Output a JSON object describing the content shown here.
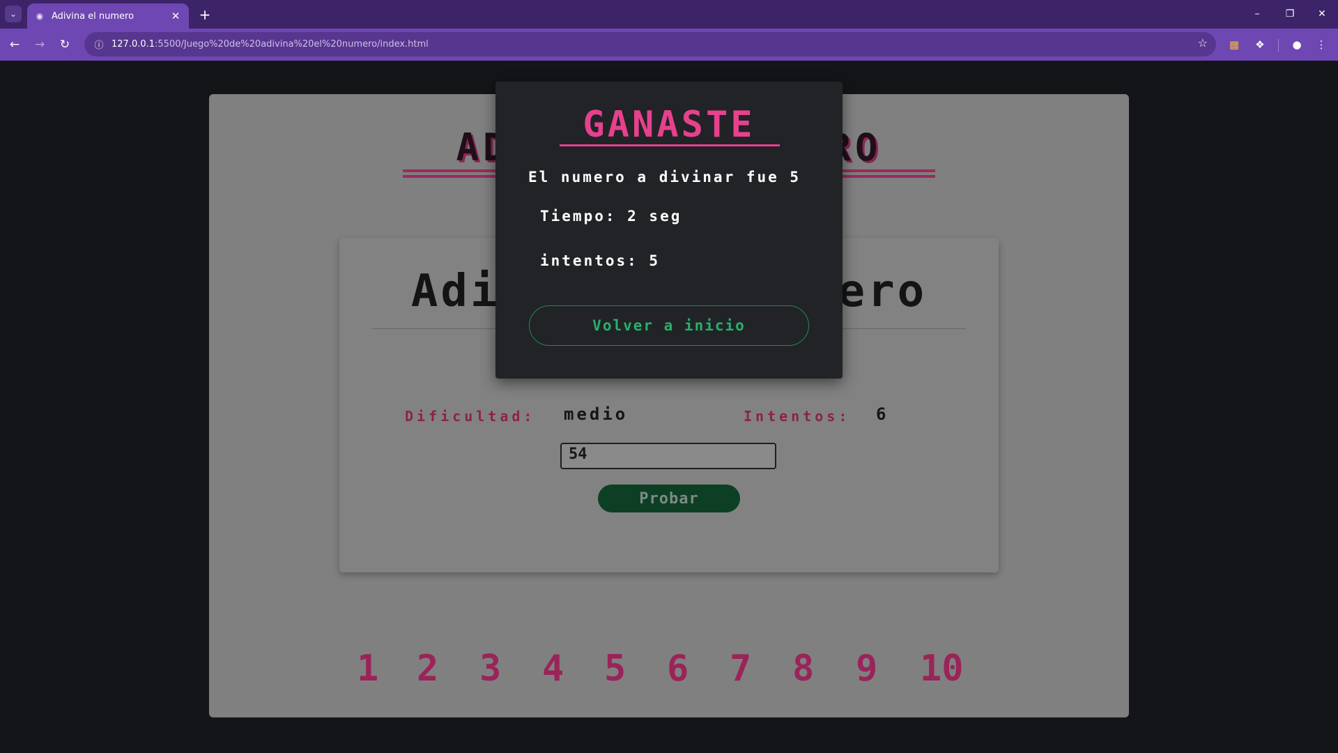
{
  "browser": {
    "tab_title": "Adivina el numero",
    "url_host": "127.0.0.1",
    "url_rest": ":5500/Juego%20de%20adivina%20el%20numero/index.html",
    "icons": {
      "tab_menu": "chevron-down-icon",
      "favicon": "incognito-icon",
      "close": "close-icon",
      "new_tab": "plus-icon",
      "back": "arrow-left-icon",
      "forward": "arrow-right-icon",
      "reload": "reload-icon",
      "site_info": "info-icon",
      "bookmark": "star-icon",
      "extension_1": "extension-icon",
      "extensions": "puzzle-icon",
      "profile": "profile-icon",
      "menu": "kebab-menu-icon",
      "minimize": "minimize-icon",
      "restore": "restore-icon",
      "window_close": "close-icon"
    },
    "colors": {
      "frame": "#3d2468",
      "toolbar": "#6f47b3",
      "omnibox": "#57368f"
    }
  },
  "page": {
    "hero_title_left": "ADI",
    "hero_title_right": "ERO",
    "card": {
      "title_left": "Adiv",
      "title_right": "nero",
      "difficulty_label": "Dificultad:",
      "difficulty_value": "medio",
      "attempts_label": "Intentos:",
      "attempts_value": "6",
      "guess_input_value": "54",
      "probar_label": "Probar"
    },
    "numbers": [
      "1",
      "2",
      "3",
      "4",
      "5",
      "6",
      "7",
      "8",
      "9",
      "10"
    ],
    "colors": {
      "accent_pink": "#e6418d",
      "number_pink": "#9a2459",
      "button_green": "#0d3f25",
      "modal_green": "#27b06c"
    }
  },
  "modal": {
    "title": "GANASTE",
    "number_line": "El numero a divinar fue 5",
    "time_line": "Tiempo: 2 seg",
    "attempts_line": "intentos: 5",
    "back_button": "Volver a inicio"
  }
}
